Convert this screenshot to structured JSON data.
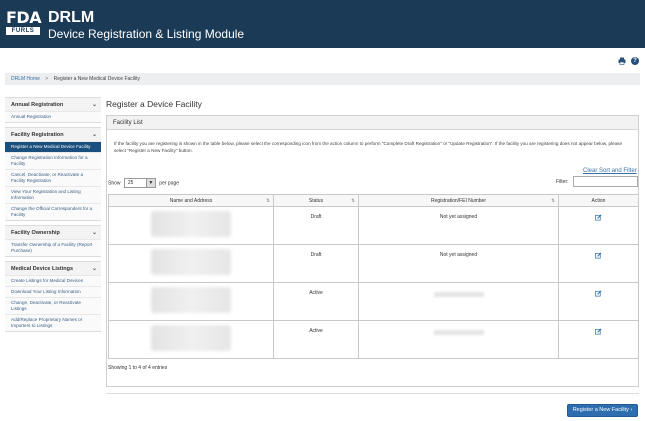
{
  "header": {
    "logo_top": "FDA",
    "logo_bottom": "FURLS",
    "title": "DRLM",
    "subtitle": "Device Registration & Listing Module"
  },
  "tools": {
    "print_icon": "print-icon",
    "help_icon": "help-icon",
    "help_glyph": "?"
  },
  "breadcrumb": {
    "home": "DRLM Home",
    "separator": ">",
    "current": "Register a New Medical Device Facility"
  },
  "sidebar": {
    "chevron": "⌄",
    "sections": [
      {
        "title": "Annual Registration",
        "items": [
          "Annual Registration"
        ]
      },
      {
        "title": "Facility Registration",
        "items": [
          "Register a New Medical Device Facility",
          "Change Registration Information for a Facility",
          "Cancel, Deactivate, or Reactivate a Facility Registration",
          "View Your Registration and Listing Information",
          "Change the Official Correspondent for a Facility"
        ]
      },
      {
        "title": "Facility Ownership",
        "items": [
          "Transfer Ownership of a Facility (Report Purchase)"
        ]
      },
      {
        "title": "Medical Device Listings",
        "items": [
          "Create Listings for Medical Devices",
          "Download Your Listing Information",
          "Change, Deactivate, or Reactivate Listings",
          "Add/Replace Proprietary Names or Importers to Listings"
        ]
      }
    ]
  },
  "main": {
    "page_title": "Register a Device Facility",
    "panel_title": "Facility List",
    "info_text": "If the facility you are registering is shown in the table below, please select the corresponding icon from the action column to perform \"Complete Draft Registration\" or \"Update Registration\". If the facility you are registering does not appear below, please select \"Register a New Facility\" button.",
    "clear_link": "Clear Sort and Filter",
    "show_label": "Show",
    "show_value": "25",
    "show_arrow": "▼",
    "per_page_label": "per page",
    "filter_label": "Filter:",
    "columns": {
      "name": "Name and Address",
      "status": "Status",
      "reg": "Registration/FEI Number",
      "action": "Action"
    },
    "sort_glyph": "⇅",
    "rows": [
      {
        "status": "Draft",
        "reg": "Not yet assigned"
      },
      {
        "status": "Draft",
        "reg": "Not yet assigned"
      },
      {
        "status": "Active",
        "reg": ""
      },
      {
        "status": "Active",
        "reg": ""
      }
    ],
    "showing": "Showing 1 to 4 of 4 entries",
    "register_button": "Register a New Facility  ›"
  },
  "colors": {
    "header_bg": "#1b3a55",
    "active_nav": "#1b4f7d",
    "button": "#2e6eb0",
    "link": "#3a6fa5"
  }
}
